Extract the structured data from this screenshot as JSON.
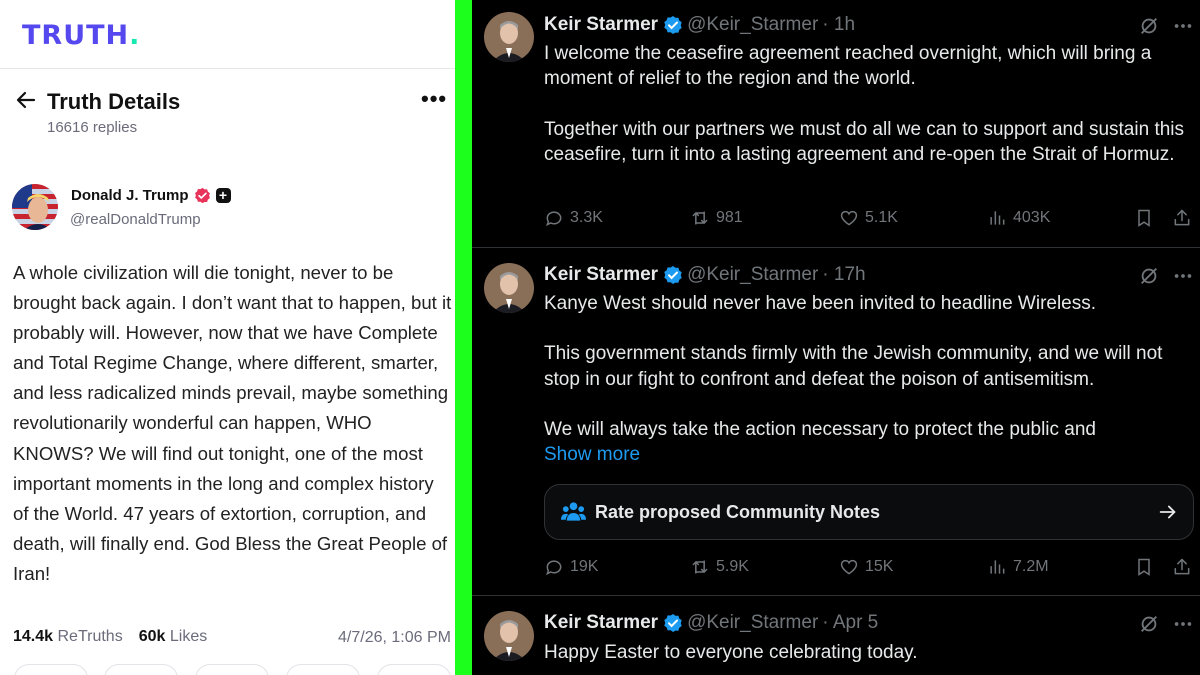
{
  "truth": {
    "logo_text": "TRUTH",
    "logo_dot": ".",
    "header_title": "Truth Details",
    "replies": "16616 replies",
    "author_name": "Donald J. Trump",
    "author_handle": "@realDonaldTrump",
    "body": "A whole civilization will die tonight, never to be brought back again. I don’t want that to happen, but it probably will. However, now that we have Complete and Total Regime Change, where different, smarter, and less radicalized minds prevail, maybe something revolutionarily wonderful can happen, WHO KNOWS? We will find out tonight, one of the most important moments in the long and complex history of the World. 47 years of extortion, corruption, and death, will finally end. God Bless the Great People of Iran!",
    "retruths_count": "14.4k",
    "retruths_label": "ReTruths",
    "likes_count": "60k",
    "likes_label": "Likes",
    "timestamp": "4/7/26, 1:06 PM",
    "accent_color": "#5448ee",
    "logo_dot_color": "#17e9b1",
    "verified_color": "#e8335a"
  },
  "x_posts": [
    {
      "author": "Keir Starmer",
      "handle": "@Keir_Starmer",
      "time": "· 1h",
      "paragraphs": [
        "I welcome the ceasefire agreement reached overnight, which will bring a moment of relief to the region and the world.",
        "Together with our partners we must do all we can to support and sustain this ceasefire, turn it into a lasting agreement and re-open the Strait of Hormuz."
      ],
      "replies": "3.3K",
      "reposts": "981",
      "likes": "5.1K",
      "views": "403K"
    },
    {
      "author": "Keir Starmer",
      "handle": "@Keir_Starmer",
      "time": "· 17h",
      "paragraphs": [
        "Kanye West should never have been invited to headline Wireless.",
        "This government stands firmly with the Jewish community, and we will not stop in our fight to confront and defeat the poison of antisemitism.",
        "We will always take the action necessary to protect the public and"
      ],
      "show_more": "Show more",
      "community_notes": "Rate proposed Community Notes",
      "replies": "19K",
      "reposts": "5.9K",
      "likes": "15K",
      "views": "7.2M"
    },
    {
      "author": "Keir Starmer",
      "handle": "@Keir_Starmer",
      "time": "· Apr 5",
      "paragraphs": [
        "Happy Easter to everyone celebrating today."
      ]
    }
  ],
  "colors": {
    "separator": "#1cff1c",
    "x_link": "#1d9bf0",
    "x_verified": "#1d9bf0",
    "x_background": "#000000"
  }
}
